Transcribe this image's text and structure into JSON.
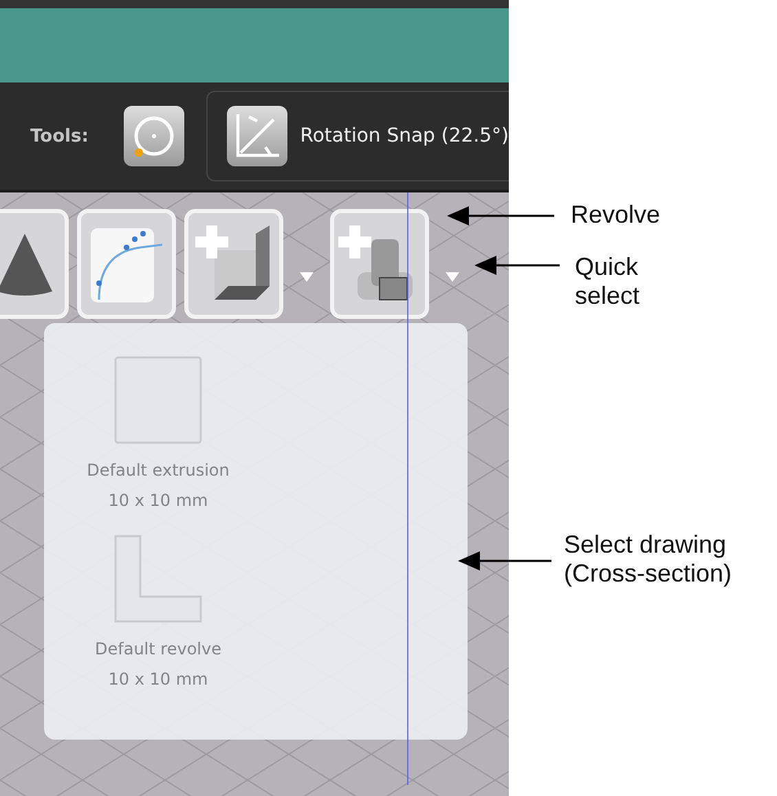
{
  "toolbar": {
    "label": "Tools:",
    "snap": {
      "label": "Rotation Snap (22.5°)"
    }
  },
  "shape_buttons": [
    {
      "kind": "cone",
      "has_menu": false
    },
    {
      "kind": "curve",
      "has_menu": false
    },
    {
      "kind": "extrude",
      "has_menu": true
    },
    {
      "kind": "revolve",
      "has_menu": true
    }
  ],
  "dropdown": {
    "items": [
      {
        "kind": "square",
        "label": "Default extrusion",
        "size": "10 x 10 mm"
      },
      {
        "kind": "l-shape",
        "label": "Default revolve",
        "size": "10 x 10 mm"
      }
    ]
  },
  "callouts": [
    {
      "label": "Revolve"
    },
    {
      "label": "Quick select"
    },
    {
      "label": "Select drawing (Cross-section)"
    }
  ]
}
